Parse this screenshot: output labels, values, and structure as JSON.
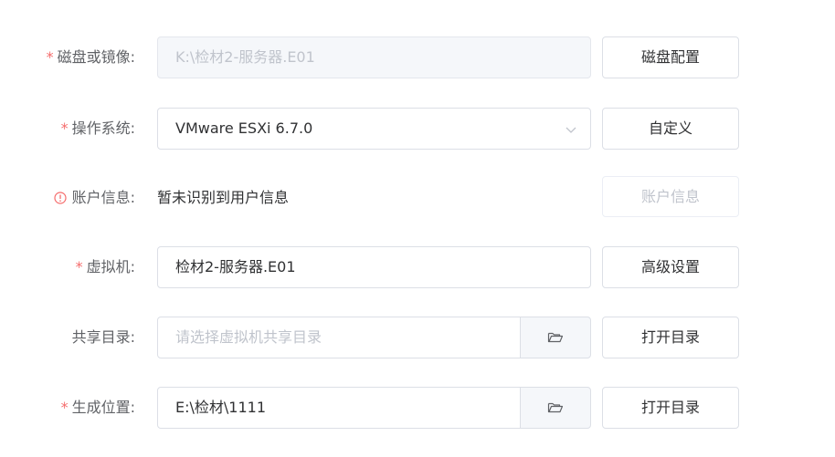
{
  "colors": {
    "required_star": "#f56c6c",
    "label": "#606266",
    "border": "#dcdfe6",
    "disabled_bg": "#f5f7fa",
    "placeholder": "#c0c4cc"
  },
  "rows": {
    "disk": {
      "required": "*",
      "label": "磁盘或镜像:",
      "value": "K:\\检材2-服务器.E01",
      "button": "磁盘配置"
    },
    "os": {
      "required": "*",
      "label": "操作系统:",
      "value": "VMware ESXi 6.7.0",
      "button": "自定义"
    },
    "account": {
      "icon": "info-circle-icon",
      "label": "账户信息:",
      "value": "暂未识别到用户信息",
      "button": "账户信息"
    },
    "vm": {
      "required": "*",
      "label": "虚拟机:",
      "value": "检材2-服务器.E01",
      "button": "高级设置"
    },
    "share": {
      "label": "共享目录:",
      "placeholder": "请选择虚拟机共享目录",
      "append_icon": "folder-open-icon",
      "button": "打开目录"
    },
    "output": {
      "required": "*",
      "label": "生成位置:",
      "value": "E:\\检材\\1111",
      "append_icon": "folder-open-icon",
      "button": "打开目录"
    }
  }
}
